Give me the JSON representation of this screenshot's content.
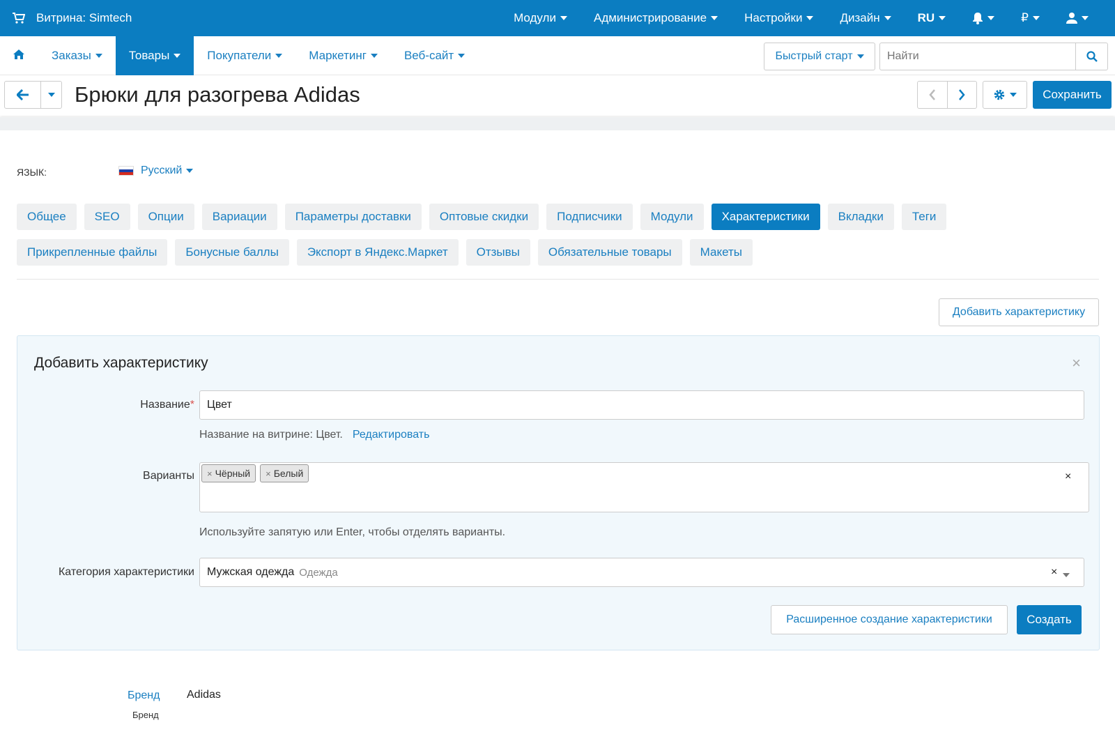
{
  "topbar": {
    "store_label": "Витрина: Simtech",
    "menu": [
      {
        "label": "Модули"
      },
      {
        "label": "Администрирование"
      },
      {
        "label": "Настройки"
      },
      {
        "label": "Дизайн"
      },
      {
        "label": "RU"
      },
      {
        "label": ""
      },
      {
        "label": "₽"
      },
      {
        "label": ""
      }
    ],
    "icons": [
      "cart-icon",
      "bell-icon",
      "user-icon"
    ]
  },
  "nav": {
    "tabs": [
      {
        "label": "Заказы"
      },
      {
        "label": "Товары"
      },
      {
        "label": "Покупатели"
      },
      {
        "label": "Маркетинг"
      },
      {
        "label": "Веб-сайт"
      }
    ],
    "active_tab": "Товары",
    "quick_start": "Быстрый старт",
    "search_placeholder": "Найти"
  },
  "title_bar": {
    "title": "Брюки для разогрева Adidas",
    "save_label": "Сохранить"
  },
  "language": {
    "label": "ЯЗЫК:",
    "value": "Русский"
  },
  "tabs_row1": [
    {
      "label": "Общее"
    },
    {
      "label": "SEO"
    },
    {
      "label": "Опции"
    },
    {
      "label": "Вариации"
    },
    {
      "label": "Параметры доставки"
    },
    {
      "label": "Оптовые скидки"
    },
    {
      "label": "Подписчики"
    },
    {
      "label": "Модули"
    },
    {
      "label": "Характеристики"
    },
    {
      "label": "Вкладки"
    },
    {
      "label": "Теги"
    }
  ],
  "tabs_row2": [
    {
      "label": "Прикрепленные файлы"
    },
    {
      "label": "Бонусные баллы"
    },
    {
      "label": "Экспорт в Яндекс.Маркет"
    },
    {
      "label": "Отзывы"
    },
    {
      "label": "Обязательные товары"
    },
    {
      "label": "Макеты"
    }
  ],
  "active_product_tab": "Характеристики",
  "add_feature_button": "Добавить характеристику",
  "panel": {
    "title": "Добавить характеристику",
    "name_label": "Название",
    "name_value": "Цвет",
    "storefront_hint": "Название на витрине: Цвет.",
    "edit_link": "Редактировать",
    "variants_label": "Варианты",
    "variants": [
      {
        "label": "Чёрный"
      },
      {
        "label": "Белый"
      }
    ],
    "variants_hint": "Используйте запятую или Enter, чтобы отделять варианты.",
    "category_label": "Категория характеристики",
    "category_value": "Мужская одежда",
    "category_parent": "Одежда",
    "advanced_button": "Расширенное создание характеристики",
    "create_button": "Создать"
  },
  "brand": {
    "link": "Бренд",
    "sub": "Бренд",
    "value": "Adidas"
  },
  "colors": {
    "primary": "#0b7dc1",
    "link": "#1a7fc1",
    "pill_bg": "#eff0f1",
    "panel_bg": "#f1f8fc"
  }
}
